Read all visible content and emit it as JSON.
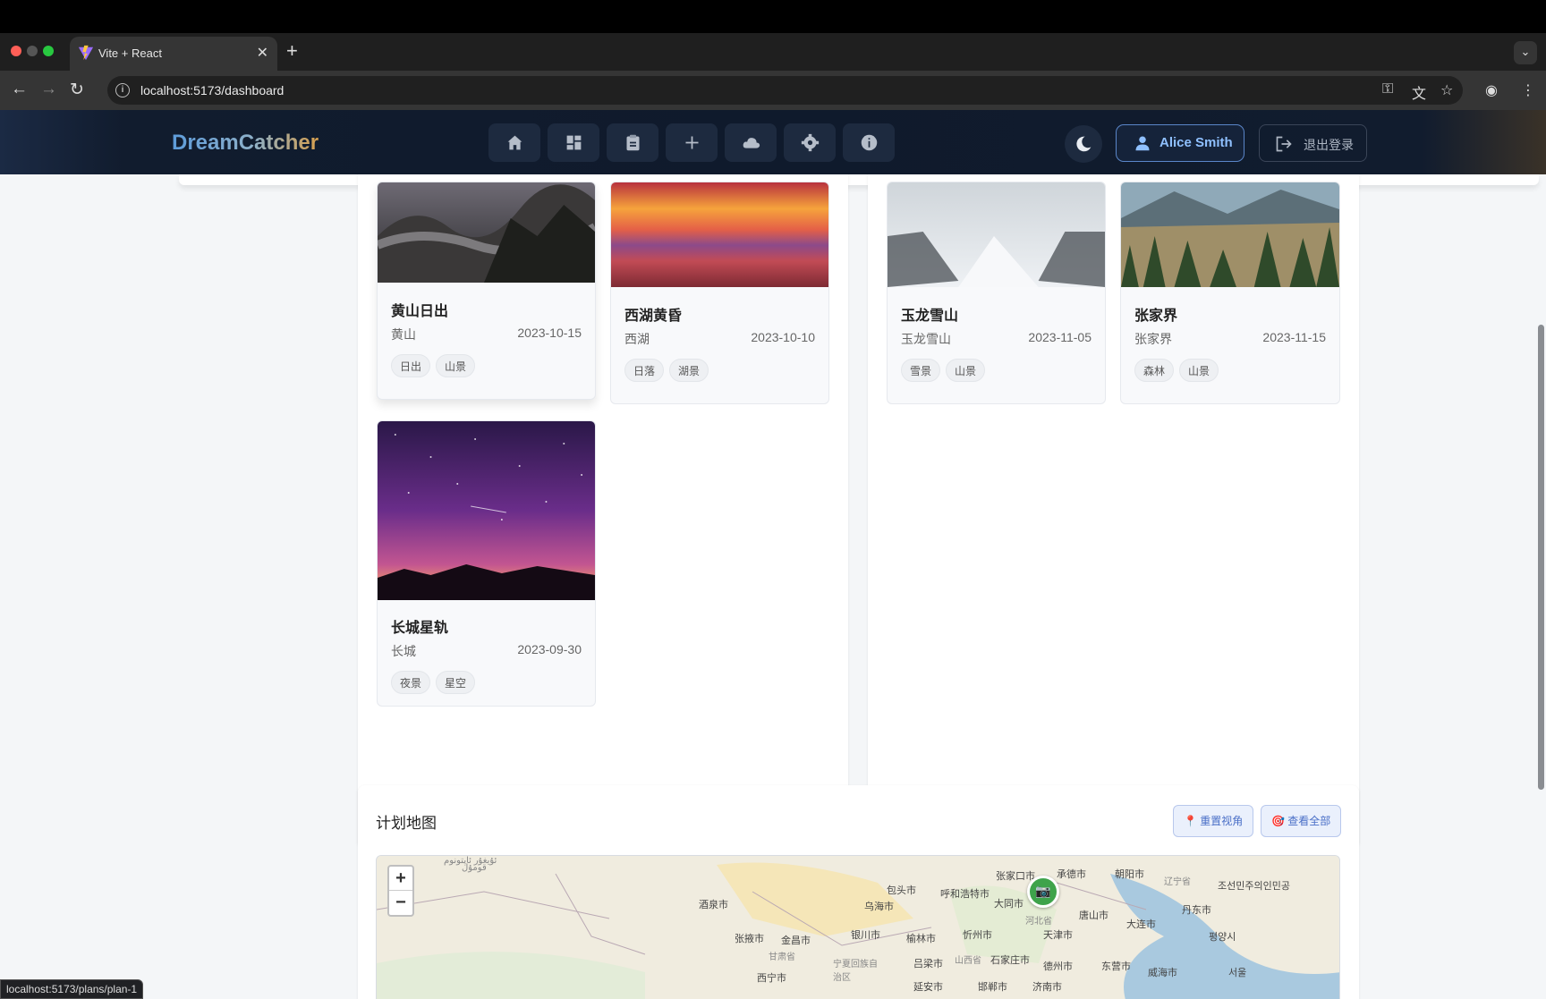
{
  "browser": {
    "tab_title": "Vite + React",
    "tab_close": "✕",
    "new_tab": "+",
    "url": "localhost:5173/dashboard",
    "status_url": "localhost:5173/plans/plan-1"
  },
  "app": {
    "brand": "DreamCatcher",
    "nav_icons": [
      "home-icon",
      "dashboard-icon",
      "clipboard-icon",
      "plus-icon",
      "cloud-icon",
      "gear-icon",
      "info-icon"
    ],
    "user_name": "Alice Smith",
    "logout_label": "退出登录"
  },
  "cards": [
    {
      "title": "黄山日出",
      "location": "黄山",
      "date": "2023-10-15",
      "tags": [
        "日出",
        "山景"
      ]
    },
    {
      "title": "西湖黄昏",
      "location": "西湖",
      "date": "2023-10-10",
      "tags": [
        "日落",
        "湖景"
      ]
    },
    {
      "title": "长城星轨",
      "location": "长城",
      "date": "2023-09-30",
      "tags": [
        "夜景",
        "星空"
      ]
    },
    {
      "title": "玉龙雪山",
      "location": "玉龙雪山",
      "date": "2023-11-05",
      "tags": [
        "雪景",
        "山景"
      ]
    },
    {
      "title": "张家界",
      "location": "张家界",
      "date": "2023-11-15",
      "tags": [
        "森林",
        "山景"
      ]
    }
  ],
  "map": {
    "title": "计划地图",
    "reset_view": "重置视角",
    "view_all": "查看全部",
    "zoom_in": "+",
    "zoom_out": "−",
    "labels": {
      "l1": "张家口市",
      "l2": "承德市",
      "l3": "朝阳市",
      "l4": "辽宁省",
      "l5": "包头市",
      "l6": "呼和浩特市",
      "l7": "乌海市",
      "l8": "大同市",
      "l9": "酒泉市",
      "l10": "河北省",
      "l11": "唐山市",
      "l12": "大连市",
      "l13": "丹东市",
      "l14": "银川市",
      "l15": "榆林市",
      "l16": "忻州市",
      "l17": "天津市",
      "l18": "张掖市",
      "l19": "金昌市",
      "l20": "甘肃省",
      "l21": "宁夏回族自治区",
      "l22": "吕梁市",
      "l23": "山西省",
      "l24": "石家庄市",
      "l25": "德州市",
      "l26": "东营市",
      "l27": "威海市",
      "l28": "西宁市",
      "l29": "延安市",
      "l30": "邯郸市",
      "l31": "济南市",
      "l32": "조선민주의인민공",
      "l33": "평양시",
      "l34": "서울",
      "l35": "ئۇيغۇر ئاپتونوم",
      "l36": "قومۇل"
    }
  },
  "colors": {
    "marker": "#3ea34b",
    "brand_start": "#5d9cdb",
    "brand_end": "#d7a04e"
  }
}
